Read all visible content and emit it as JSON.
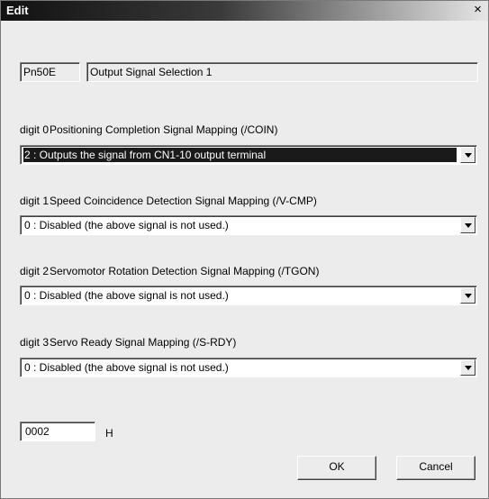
{
  "window": {
    "title": "Edit",
    "close_symbol": "×"
  },
  "parameter": {
    "number": "Pn50E",
    "name": "Output Signal Selection 1"
  },
  "digits": [
    {
      "digit": "digit 0",
      "label": "Positioning Completion Signal Mapping (/COIN)",
      "selected_value": "2 : Outputs the signal from CN1-10 output terminal"
    },
    {
      "digit": "digit 1",
      "label": "Speed Coincidence Detection Signal Mapping (/V-CMP)",
      "selected_value": "0 : Disabled (the above signal is not used.)"
    },
    {
      "digit": "digit 2",
      "label": "Servomotor Rotation Detection Signal Mapping (/TGON)",
      "selected_value": "0 : Disabled (the above signal is not used.)"
    },
    {
      "digit": "digit 3",
      "label": "Servo Ready Signal Mapping (/S-RDY)",
      "selected_value": "0 : Disabled (the above signal is not used.)"
    }
  ],
  "value": {
    "hex": "0002",
    "unit": "H"
  },
  "buttons": {
    "ok": "OK",
    "cancel": "Cancel"
  }
}
